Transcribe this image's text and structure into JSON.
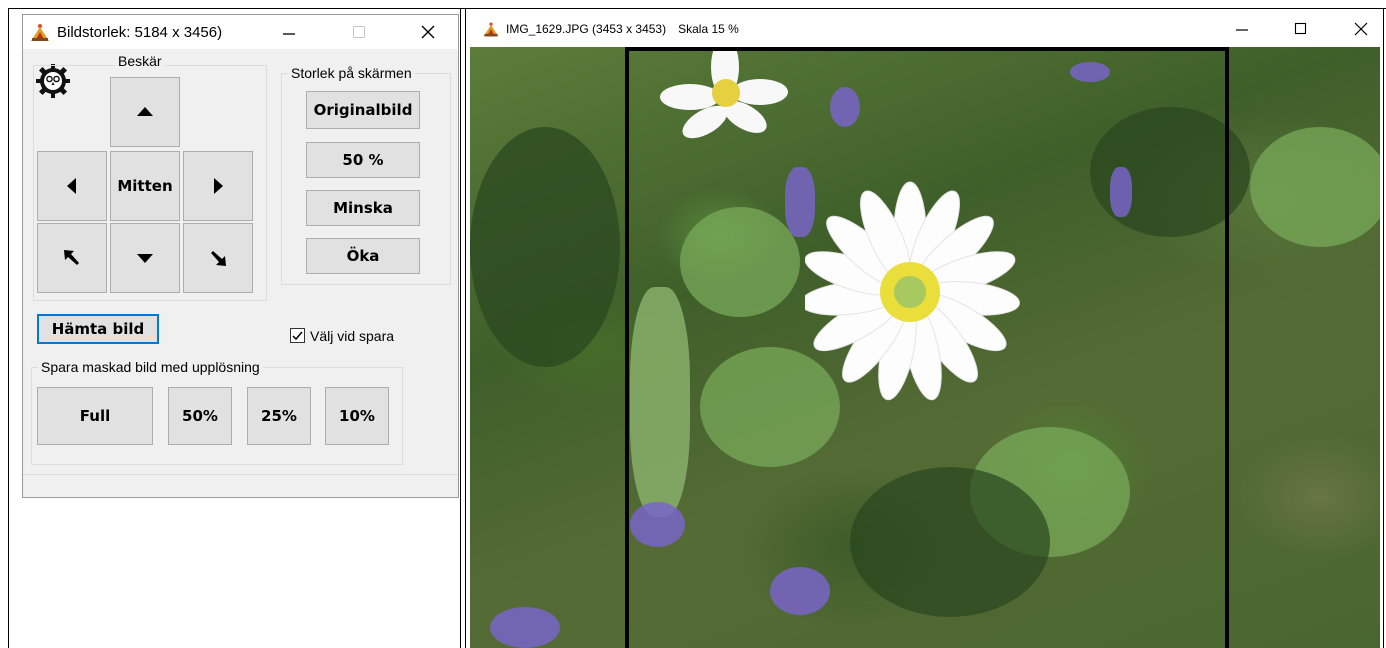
{
  "left_window": {
    "title": "Bildstorlek: 5184 x 3456)",
    "crop_group": {
      "label": "Beskär",
      "up_icon": "arrow-up-icon",
      "left_icon": "arrow-left-icon",
      "center_label": "Mitten",
      "right_icon": "arrow-right-icon",
      "upleft_icon": "arrow-up-left-icon",
      "down_icon": "arrow-down-icon",
      "downright_icon": "arrow-down-right-icon"
    },
    "screen_size_group": {
      "label": "Storlek på skärmen",
      "original_label": "Originalbild",
      "half_label": "50 %",
      "decrease_label": "Minska",
      "increase_label": "Öka"
    },
    "load_button_label": "Hämta bild",
    "choose_on_save_label": "Välj vid spara",
    "choose_on_save_checked": true,
    "save_group": {
      "label": "Spara maskad bild med upplösning",
      "full_label": "Full",
      "p50_label": "50%",
      "p25_label": "25%",
      "p10_label": "10%"
    }
  },
  "right_window": {
    "title": "IMG_1629.JPG (3453 x 3453)",
    "scale_label": "Skala 15 %"
  },
  "colors": {
    "focus_border": "#0078d7",
    "button_bg": "#e1e1e1",
    "window_bg": "#f0f0f0"
  }
}
